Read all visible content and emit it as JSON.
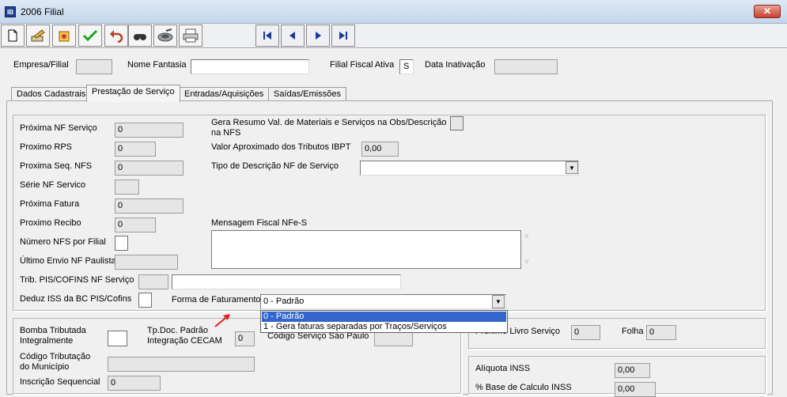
{
  "window": {
    "title": "2006 Filial",
    "icon_text": "IB",
    "close_label": "✕"
  },
  "toolbar": {
    "buttons": [
      "new-icon",
      "edit-icon",
      "delete-icon",
      "save-icon",
      "undo-icon",
      "search-icon",
      "export-icon",
      "print-icon"
    ],
    "nav": [
      "first-record-icon",
      "previous-record-icon",
      "next-record-icon",
      "last-record-icon"
    ]
  },
  "header": {
    "empresa_label": "Empresa/Filial",
    "empresa_value": "",
    "fantasia_label": "Nome Fantasia",
    "fantasia_value": "",
    "fiscal_label": "Filial Fiscal Ativa",
    "fiscal_value": "S",
    "inativacao_label": "Data Inativação",
    "inativacao_value": ""
  },
  "tabs": [
    {
      "label": "Dados Cadastrais",
      "active": false
    },
    {
      "label": "Prestação de Serviço",
      "active": true
    },
    {
      "label": "Entradas/Aquisições",
      "active": false
    },
    {
      "label": "Saídas/Emissões",
      "active": false
    }
  ],
  "form": {
    "proxima_nf_label": "Próxima NF Serviço",
    "proxima_nf_value": "0",
    "proximo_rps_label": "Proximo RPS",
    "proximo_rps_value": "0",
    "proxima_seq_label": "Proxima Seq. NFS",
    "proxima_seq_value": "0",
    "serie_label": "Série NF Servico",
    "serie_value": "",
    "proxima_fatura_label": "Próxima Fatura",
    "proxima_fatura_value": "0",
    "proximo_recibo_label": "Proximo Recibo",
    "proximo_recibo_value": "0",
    "numero_nfs_label": "Número NFS por Filial",
    "ultimo_envio_label": "Último Envio NF Paulista",
    "ultimo_envio_value": "",
    "trib_pis_label": "Trib. PIS/COFINS NF Serviço",
    "trib_pis_code": "",
    "trib_pis_desc": "",
    "deduz_iss_label": "Deduz ISS da BC PIS/Cofins",
    "gera_resumo_label_1": "Gera Resumo Val. de Materiais e Serviços na Obs/Descrição",
    "gera_resumo_label_2": "na NFS",
    "valor_ibpt_label": "Valor Aproximado dos Tributos IBPT",
    "valor_ibpt_value": "0,00",
    "tipo_desc_label": "Tipo de Descrição NF de Serviço",
    "tipo_desc_value": "",
    "mensagem_label": "Mensagem Fiscal NFe-S",
    "mensagem_value": "",
    "forma_fat_label": "Forma de Faturamento",
    "forma_fat_value": "0 - Padrão",
    "forma_fat_options": [
      "0 - Padrão",
      "1 - Gera faturas separadas por Traços/Serviços"
    ]
  },
  "lower": {
    "bomba_label_1": "Bomba Tributada",
    "bomba_label_2": "Integralmente",
    "tpdoc_label_1": "Tp.Doc. Padrão",
    "tpdoc_label_2": "Integração CECAM",
    "tpdoc_value": "0",
    "cod_sp_label": "Código Serviço São Paulo",
    "cod_sp_value": "",
    "cod_trib_label_1": "Código Tributação",
    "cod_trib_label_2": "do Município",
    "cod_trib_value": "",
    "insc_label": "Inscrição Sequencial",
    "insc_value": "0",
    "proximo_livro_label": "Próximo Livro Serviço",
    "proximo_livro_value": "0",
    "folha_label": "Folha",
    "folha_value": "0",
    "aliquota_label": "Alíquota INSS",
    "aliquota_value": "0,00",
    "base_calc_label": "% Base de Calculo INSS",
    "base_calc_value": "0,00"
  },
  "colors": {
    "selection": "#3366cc",
    "pointer_arrow": "#e02020",
    "nav_arrows": "#1a3b9c"
  }
}
